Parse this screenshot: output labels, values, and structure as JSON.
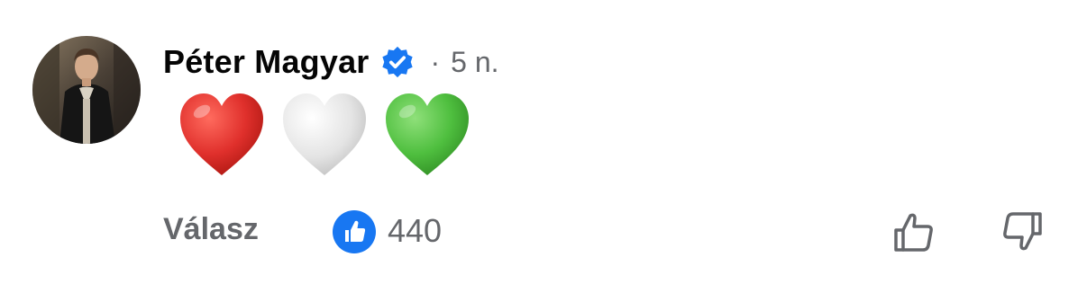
{
  "comment": {
    "author": "Péter Magyar",
    "separator": "·",
    "time": "5 n.",
    "content_hearts": [
      "red-heart",
      "white-heart",
      "green-heart"
    ],
    "reply_label": "Válasz",
    "like_count": "440"
  },
  "colors": {
    "verified_badge": "#1877f2",
    "like_badge": "#1877f2",
    "secondary_text": "#65676b",
    "primary_text": "#050505",
    "heart_red": "#e0302c",
    "heart_white": "#dcdcdc",
    "heart_green": "#4fbf3f"
  }
}
